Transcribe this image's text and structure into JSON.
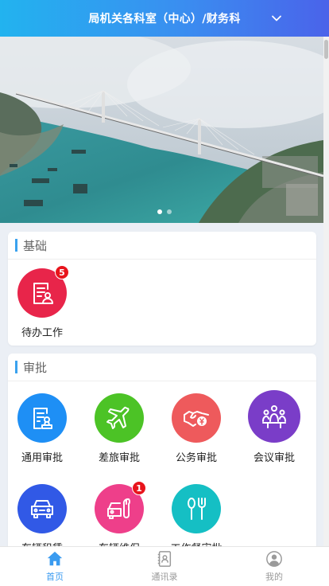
{
  "header": {
    "title": "局机关各科室（中心）/财务科"
  },
  "banner": {
    "slide_count": 2,
    "active_slide": 1
  },
  "sections": {
    "basic": {
      "title": "基础",
      "items": [
        {
          "label": "待办工作",
          "icon": "todo-icon",
          "color": "#e8254a",
          "badge": "5"
        }
      ]
    },
    "approval": {
      "title": "审批",
      "items": [
        {
          "label": "通用审批",
          "icon": "document-approval-icon",
          "color": "#1e8ff5"
        },
        {
          "label": "差旅审批",
          "icon": "airplane-icon",
          "color": "#4cc326"
        },
        {
          "label": "公务审批",
          "icon": "handshake-icon",
          "color": "#ee5a5c"
        },
        {
          "label": "会议审批",
          "icon": "meeting-icon",
          "color": "#7a3dc8"
        },
        {
          "label": "车辆租赁",
          "icon": "car-icon",
          "color": "#3159e6"
        },
        {
          "label": "车辆维保",
          "icon": "car-repair-icon",
          "color": "#ee3f8a",
          "badge": "1"
        },
        {
          "label": "工作餐审批",
          "icon": "cutlery-icon",
          "color": "#15bfc4"
        }
      ]
    }
  },
  "tabbar": {
    "items": [
      {
        "label": "首页",
        "icon": "home-icon",
        "active": true
      },
      {
        "label": "通讯录",
        "icon": "contacts-icon",
        "active": false
      },
      {
        "label": "我的",
        "icon": "profile-icon",
        "active": false
      }
    ]
  },
  "colors": {
    "accent": "#3a9bf0",
    "header_start": "#22b3ef",
    "header_end": "#4a63ea",
    "badge": "#e8141c"
  }
}
